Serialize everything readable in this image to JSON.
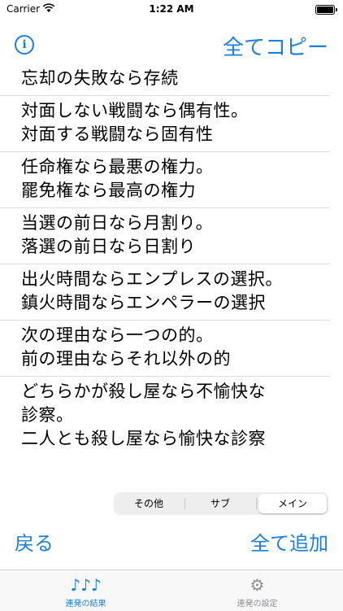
{
  "status_bar": {
    "carrier": "Carrier",
    "time": "1:22 AM"
  },
  "nav": {
    "info_icon": "info-icon",
    "copy_all_label": "全てコピー"
  },
  "results": [
    {
      "lines": [
        "忘却の失敗なら存続"
      ]
    },
    {
      "lines": [
        "対面しない戦闘なら偶有性。",
        "対面する戦闘なら固有性"
      ]
    },
    {
      "lines": [
        "任命権なら最悪の権力。",
        "罷免権なら最高の権力"
      ]
    },
    {
      "lines": [
        "当選の前日なら月割り。",
        "落選の前日なら日割り"
      ]
    },
    {
      "lines": [
        "出火時間ならエンプレスの選択。",
        "鎮火時間ならエンペラーの選択"
      ]
    },
    {
      "lines": [
        "次の理由なら一つの的。",
        "前の理由ならそれ以外の的"
      ]
    },
    {
      "lines": [
        "どちらかが殺し屋なら不愉快な",
        "診察。",
        "二人とも殺し屋なら愉快な診察"
      ]
    }
  ],
  "segmented": {
    "options": [
      "その他",
      "サブ",
      "メイン"
    ],
    "selected": "メイン"
  },
  "bottom_actions": {
    "back_label": "戻る",
    "add_all_label": "全て追加"
  },
  "tab_bar": {
    "tabs": [
      {
        "label": "連発の結果",
        "icon": "music-notes-icon",
        "glyph": "♪♪♪",
        "active": true
      },
      {
        "label": "連発の設定",
        "icon": "gear-icon",
        "glyph": "⚙",
        "active": false
      }
    ]
  },
  "colors": {
    "accent": "#1a7fe0",
    "inactive": "#8e8e93",
    "separator": "#dcdcdc"
  }
}
